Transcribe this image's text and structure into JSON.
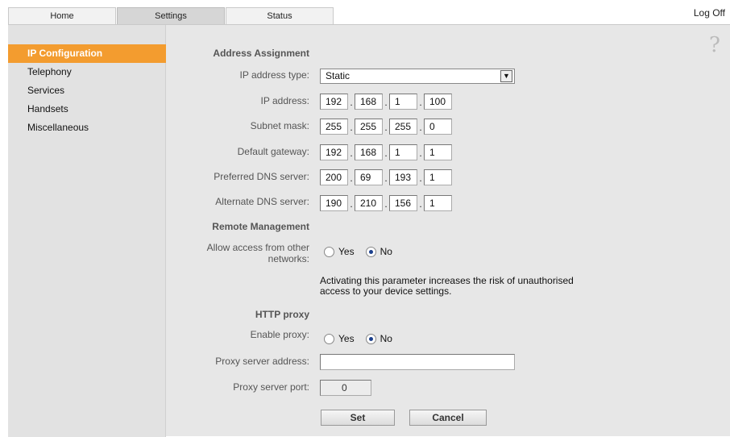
{
  "tabs": {
    "home": "Home",
    "settings": "Settings",
    "status": "Status"
  },
  "logoff": "Log Off",
  "help": "?",
  "sidebar": {
    "items": [
      {
        "label": "IP Configuration"
      },
      {
        "label": "Telephony"
      },
      {
        "label": "Services"
      },
      {
        "label": "Handsets"
      },
      {
        "label": "Miscellaneous"
      }
    ]
  },
  "address": {
    "heading": "Address Assignment",
    "ip_type_label": "IP address type:",
    "ip_type_value": "Static",
    "ip_label": "IP address:",
    "ip": [
      "192",
      "168",
      "1",
      "100"
    ],
    "subnet_label": "Subnet mask:",
    "subnet": [
      "255",
      "255",
      "255",
      "0"
    ],
    "gateway_label": "Default gateway:",
    "gateway": [
      "192",
      "168",
      "1",
      "1"
    ],
    "dns1_label": "Preferred DNS server:",
    "dns1": [
      "200",
      "69",
      "193",
      "1"
    ],
    "dns2_label": "Alternate DNS server:",
    "dns2": [
      "190",
      "210",
      "156",
      "1"
    ],
    "dot": "."
  },
  "remote": {
    "heading": "Remote Management",
    "allow_label_1": "Allow access from other",
    "allow_label_2": "networks:",
    "yes": "Yes",
    "no": "No",
    "note_1": "Activating this parameter increases the risk of unauthorised",
    "note_2": "access to your device settings."
  },
  "proxy": {
    "heading": "HTTP proxy",
    "enable_label": "Enable proxy:",
    "yes": "Yes",
    "no": "No",
    "address_label": "Proxy server address:",
    "address_value": "",
    "port_label": "Proxy server port:",
    "port_value": "0"
  },
  "buttons": {
    "set": "Set",
    "cancel": "Cancel"
  }
}
